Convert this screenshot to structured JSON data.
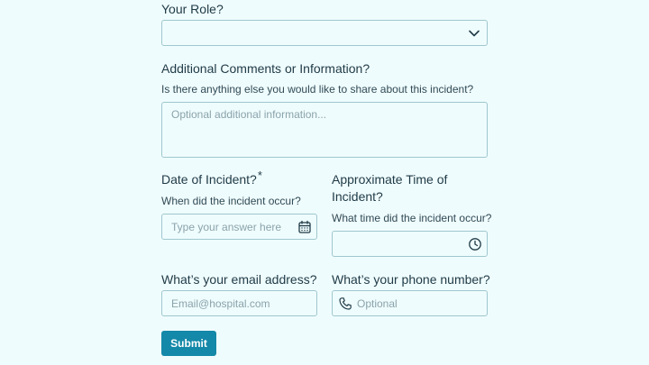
{
  "role": {
    "label": "Your Role?",
    "selected": ""
  },
  "comments": {
    "label": "Additional Comments or Information?",
    "help": "Is there anything else you would like to share about this incident?",
    "placeholder": "Optional additional information..."
  },
  "date": {
    "label": "Date of Incident?",
    "required_mark": "*",
    "help": "When did the incident occur?",
    "placeholder": "Type your answer here"
  },
  "time": {
    "label": "Approximate Time of Incident?",
    "help": "What time did the incident occur?",
    "value": ""
  },
  "email": {
    "label": "What’s your email address?",
    "placeholder": "Email@hospital.com"
  },
  "phone": {
    "label": "What’s your phone number?",
    "placeholder": "Optional"
  },
  "submit": {
    "label": "Submit"
  },
  "colors": {
    "background": "#effcfd",
    "border": "#9fc7cf",
    "text": "#1f3a46",
    "accent": "#1488a8"
  },
  "icons": {
    "select": "chevron-down-icon",
    "date": "calendar-icon",
    "time": "clock-icon",
    "phone": "phone-icon"
  }
}
